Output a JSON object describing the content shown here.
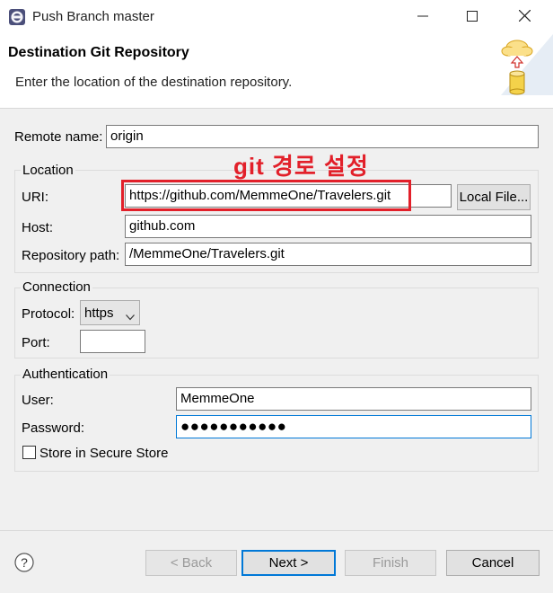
{
  "window": {
    "title": "Push Branch master",
    "controls": [
      "minimize-icon",
      "maximize-icon",
      "close-icon"
    ]
  },
  "header": {
    "title": "Destination Git Repository",
    "description": "Enter the location of the destination repository.",
    "banner_icon": "cloud-upload-database-icon"
  },
  "remote": {
    "label": "Remote name:",
    "value": "origin"
  },
  "location": {
    "group_title": "Location",
    "uri_label": "URI:",
    "uri_value": "https://github.com/MemmeOne/Travelers.git",
    "local_file_button": "Local File...",
    "host_label": "Host:",
    "host_value": "github.com",
    "repo_path_label": "Repository path:",
    "repo_path_value": "/MemmeOne/Travelers.git"
  },
  "annotation": {
    "text": "git 경로 설정",
    "color": "#e2202a"
  },
  "connection": {
    "group_title": "Connection",
    "protocol_label": "Protocol:",
    "protocol_value": "https",
    "port_label": "Port:",
    "port_value": ""
  },
  "authentication": {
    "group_title": "Authentication",
    "user_label": "User:",
    "user_value": "MemmeOne",
    "password_label": "Password:",
    "password_value": "●●●●●●●●●●●",
    "store_label": "Store in Secure Store",
    "store_checked": false
  },
  "footer": {
    "help_icon": "help-icon",
    "back_label": "< Back",
    "next_label": "Next >",
    "finish_label": "Finish",
    "cancel_label": "Cancel"
  },
  "colors": {
    "accent": "#0078d7",
    "annotation": "#e2202a",
    "background": "#f0f0f0"
  }
}
